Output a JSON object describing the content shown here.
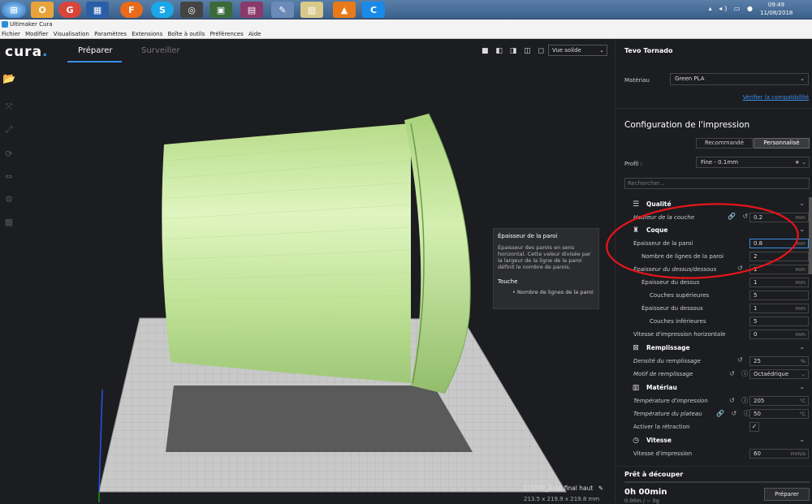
{
  "taskbar": {
    "clock_time": "09:49",
    "clock_date": "11/08/2018",
    "tray": "▴ ◂) ▭ ●",
    "apps": [
      "e",
      "O",
      "G",
      "▦",
      "F",
      "S",
      "◎",
      "▣",
      "▤",
      "✎",
      "▥",
      "▲",
      "C"
    ]
  },
  "window": {
    "title": "Ultimaker Cura"
  },
  "menu": [
    "Fichier",
    "Modifier",
    "Visualisation",
    "Paramètres",
    "Extensions",
    "Boîte à outils",
    "Préférences",
    "Aide"
  ],
  "header": {
    "logo": "cura",
    "logo_dot": ".",
    "tabs": [
      "Préparer",
      "Surveiller"
    ],
    "view_icons": "■ ◧ ◨ ◫ ◻",
    "view_mode": "Vue solide",
    "chevron": "⌄"
  },
  "left_tools": [
    "⊞",
    "⤧",
    "⤢",
    "⟳",
    "⇔",
    "⚙",
    "▦"
  ],
  "tooltip": {
    "title": "Épaisseur de la paroi",
    "description": "Épaisseur des parois en sens horizontal. Cette valeur divisée par la largeur de la ligne de la paroi définit le nombre de parois.",
    "affects_title": "Touche",
    "affects_item": "• Nombre de lignes de la paroi"
  },
  "object": {
    "name": "CFDMP_Areo final haut",
    "dims": "213.5 x 219.9 x 219.8 mm",
    "edit_icon": "✎"
  },
  "panel": {
    "printer": "Tevo Tornado",
    "material_label": "Matériau",
    "material_value": "Green PLA",
    "compat_link": "Vérifier la compatibilité",
    "config_title": "Configuration de l'impression",
    "mode_recommended": "Recommandé",
    "mode_custom": "Personnalisé",
    "profile_label": "Profil :",
    "profile_value": "Fine - 0.1mm",
    "profile_icons": "★ ⌄",
    "search_placeholder": "Rechercher...",
    "ready_title": "Prêt à découper",
    "time": "0h 00min",
    "sub": "0.00m / ~ 0g",
    "prepare_button": "Préparer"
  },
  "categories": {
    "qualite": {
      "label": "Qualité",
      "icon": "☰",
      "arrow": "⌄"
    },
    "coque": {
      "label": "Coque",
      "icon": "♜",
      "arrow": "⌄"
    },
    "remplissage": {
      "label": "Remplissage",
      "icon": "⊠",
      "arrow": "⌄"
    },
    "materiau": {
      "label": "Matériau",
      "icon": "▥",
      "arrow": "⌄"
    },
    "vitesse": {
      "label": "Vitesse",
      "icon": "◷",
      "arrow": "⌄"
    }
  },
  "settings": {
    "hauteur_couche": {
      "label": "Hauteur de la couche",
      "icons": "🔗 ↺",
      "value": "0.2",
      "unit": "mm"
    },
    "epaisseur_paroi": {
      "label": "Épaisseur de la paroi",
      "value": "0.8",
      "unit": "mm"
    },
    "lignes_paroi": {
      "label": "Nombre de lignes de la paroi",
      "value": "2"
    },
    "epaisseur_dessus_dessous": {
      "label": "Épaisseur du dessus/dessous",
      "icons": "↺",
      "value": "1",
      "unit": "mm"
    },
    "epaisseur_dessus": {
      "label": "Épaisseur du dessus",
      "value": "1",
      "unit": "mm"
    },
    "couches_sup": {
      "label": "Couches supérieures",
      "value": "5"
    },
    "epaisseur_dessous": {
      "label": "Épaisseur du dessous",
      "value": "1",
      "unit": "mm"
    },
    "couches_inf": {
      "label": "Couches inférieures",
      "value": "5"
    },
    "vitesse_horiz": {
      "label": "Vitesse d'impression horizontale",
      "value": "0",
      "unit": "mm"
    },
    "densite_remplissage": {
      "label": "Densité du remplissage",
      "icons": "↺",
      "value": "25",
      "unit": "%"
    },
    "motif_remplissage": {
      "label": "Motif de remplissage",
      "icons": "↺ ⓘ",
      "value": "Octaédrique",
      "arrow": "⌄"
    },
    "temp_impression": {
      "label": "Température d'impression",
      "icons": "↺ ⓘ",
      "value": "205",
      "unit": "°C"
    },
    "temp_plateau": {
      "label": "Température du plateau",
      "icons": "🔗 ↺ ⓘ",
      "value": "50",
      "unit": "°C"
    },
    "retraction": {
      "label": "Activer la rétraction",
      "check": "✓"
    },
    "vitesse_impression": {
      "label": "Vitesse d'impression",
      "value": "60",
      "unit": "mm/s"
    }
  },
  "colors": {
    "accent": "#3a8fe8",
    "model": "#c8e6a0",
    "annotation": "#e8151b"
  }
}
